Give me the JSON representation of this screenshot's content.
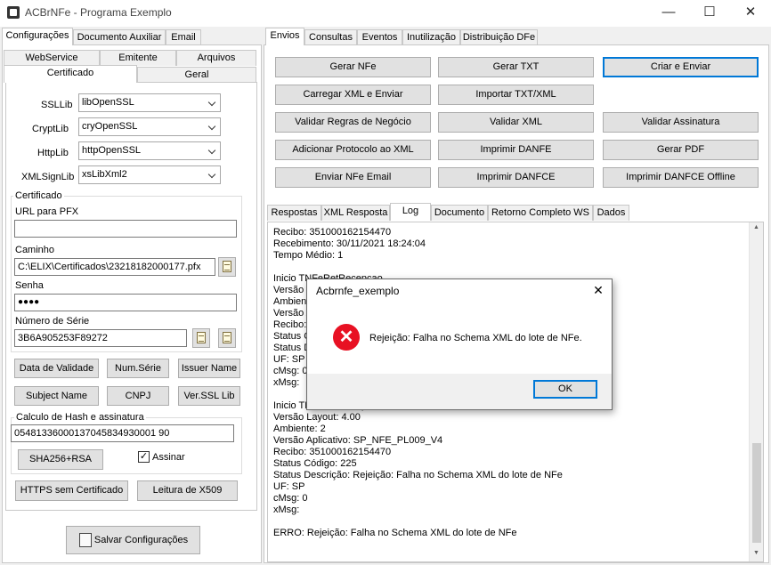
{
  "window": {
    "title": "ACBrNFe - Programa Exemplo",
    "min": "—",
    "max": "☐",
    "close": "✕"
  },
  "left_tabs": [
    "Configurações",
    "Documento Auxiliar",
    "Email"
  ],
  "config_tabs_row1": [
    "WebService",
    "Emitente",
    "Arquivos"
  ],
  "config_tabs_row2": [
    "Certificado",
    "Geral"
  ],
  "libs": [
    {
      "label": "SSLLib",
      "value": "libOpenSSL"
    },
    {
      "label": "CryptLib",
      "value": "cryOpenSSL"
    },
    {
      "label": "HttpLib",
      "value": "httpOpenSSL"
    },
    {
      "label": "XMLSignLib",
      "value": "xsLibXml2"
    }
  ],
  "certificado": {
    "group_title": "Certificado",
    "url_label": "URL para PFX",
    "url_value": "",
    "caminho_label": "Caminho",
    "caminho_value": "C:\\ELIX\\Certificados\\23218182000177.pfx",
    "senha_label": "Senha",
    "senha_value": "●●●●",
    "serie_label": "Número de Série",
    "serie_value": "3B6A905253F89272"
  },
  "cert_buttons": [
    "Data de Validade",
    "Num.Série",
    "Issuer Name",
    "Subject Name",
    "CNPJ",
    "Ver.SSL Lib"
  ],
  "hash": {
    "group_title": "Calculo de Hash e assinatura",
    "value": "05481336000137045834930001 90",
    "sha_button": "SHA256+RSA",
    "assinar_label": "Assinar",
    "assinar_mark": "✓"
  },
  "bottom_buttons": [
    "HTTPS sem Certificado",
    "Leitura de X509"
  ],
  "save_button": "Salvar Configurações",
  "right_tabs": [
    "Envios",
    "Consultas",
    "Eventos",
    "Inutilização",
    "Distribuição DFe"
  ],
  "action_buttons": [
    [
      "Gerar NFe",
      "Gerar TXT",
      "Criar e Enviar"
    ],
    [
      "Carregar XML e Enviar",
      "Importar TXT/XML",
      ""
    ],
    [
      "Validar Regras de Negócio",
      "Validar XML",
      "Validar Assinatura"
    ],
    [
      "Adicionar Protocolo ao XML",
      "Imprimir DANFE",
      "Gerar PDF"
    ],
    [
      "Enviar NFe Email",
      "Imprimir DANFCE",
      "Imprimir DANFCE Offline"
    ]
  ],
  "result_tabs": [
    "Respostas",
    "XML Resposta",
    "Log",
    "Documento",
    "Retorno Completo WS",
    "Dados"
  ],
  "log_lines": [
    "Recibo: 351000162154470",
    "Recebimento: 30/11/2021 18:24:04",
    "Tempo Médio: 1",
    "",
    "Inicio TNFeRetRecepcao",
    "Versão Layout: 4.00",
    "Ambiente: 2",
    "Versão Aplicativo: SP_NFE_PL009_V4",
    "Recibo: 351000162154470",
    "Status Código: 225",
    "Status Descrição: Rejeição: Falha no Schema XML do lote de NFe",
    "UF: SP",
    "cMsg: 0",
    "xMsg:",
    "",
    "Inicio TNFeRetRecepcao",
    "Versão Layout: 4.00",
    "Ambiente: 2",
    "Versão Aplicativo: SP_NFE_PL009_V4",
    "Recibo: 351000162154470",
    "Status Código: 225",
    "Status Descrição: Rejeição: Falha no Schema XML do lote de NFe",
    "UF: SP",
    "cMsg: 0",
    "xMsg:",
    "",
    "ERRO: Rejeição: Falha no Schema XML do lote de NFe"
  ],
  "dialog": {
    "title": "Acbrnfe_exemplo",
    "message": "Rejeição: Falha no Schema XML do lote de NFe.",
    "ok": "OK",
    "close": "✕",
    "icon": "✕"
  }
}
